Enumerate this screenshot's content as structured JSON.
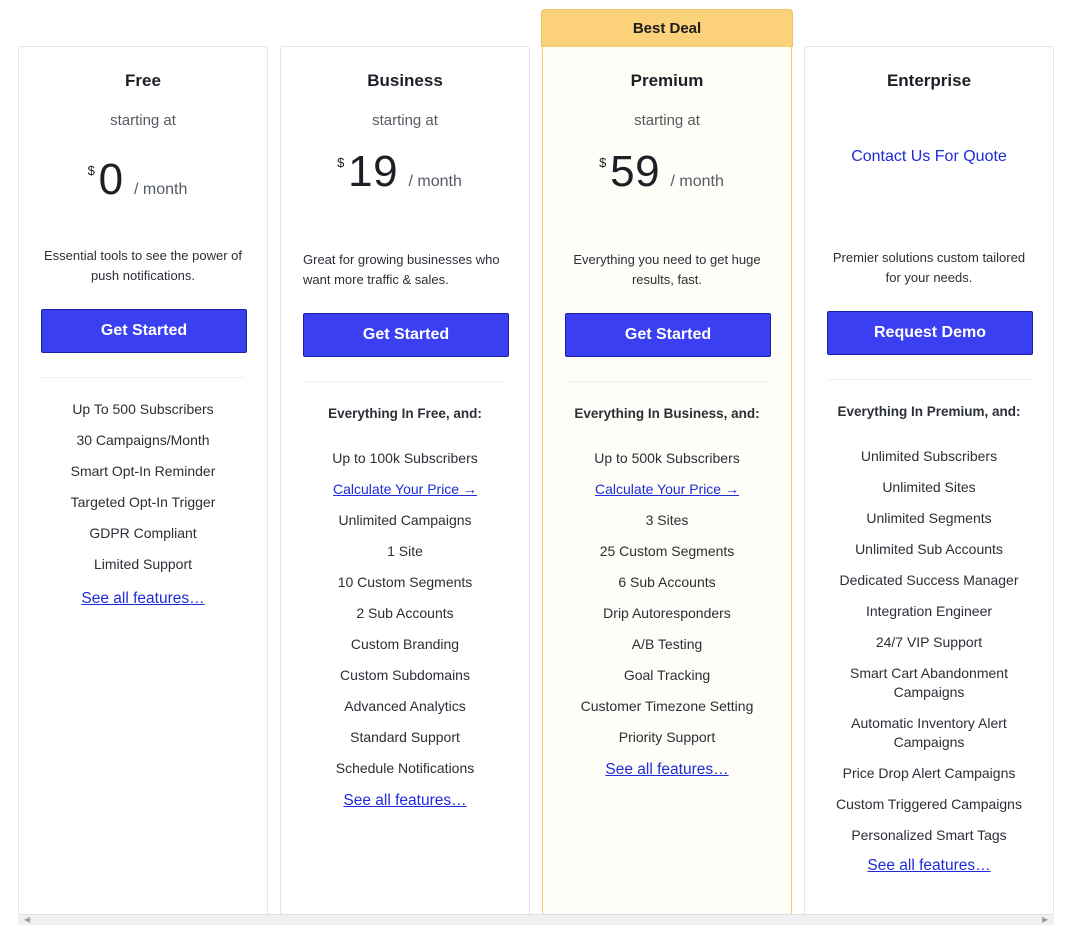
{
  "badge": "Best Deal",
  "plans": [
    {
      "name": "Free",
      "starting": "starting at",
      "currency": "$",
      "amount": "0",
      "per": "/ month",
      "description": "Essential tools to see the power of push notifications.",
      "button": "Get Started",
      "features": [
        "Up To 500 Subscribers",
        "30 Campaigns/Month",
        "Smart Opt-In Reminder",
        "Targeted Opt-In Trigger",
        "GDPR Compliant",
        "Limited Support"
      ],
      "see_all": "See all features…"
    },
    {
      "name": "Business",
      "starting": "starting at",
      "currency": "$",
      "amount": "19",
      "per": "/ month",
      "description": "Great for growing businesses who want more traffic & sales.",
      "button": "Get Started",
      "feature_head": "Everything In Free, and:",
      "features": [
        "Up to 100k Subscribers",
        "Calculate Your Price →",
        "Unlimited Campaigns",
        "1 Site",
        "10 Custom Segments",
        "2 Sub Accounts",
        "Custom Branding",
        "Custom Subdomains",
        "Advanced Analytics",
        "Standard Support",
        "Schedule Notifications"
      ],
      "see_all": "See all features…"
    },
    {
      "name": "Premium",
      "starting": "starting at",
      "currency": "$",
      "amount": "59",
      "per": "/ month",
      "description": "Everything you need to get huge results, fast.",
      "button": "Get Started",
      "feature_head": "Everything In Business, and:",
      "features": [
        "Up to 500k Subscribers",
        "Calculate Your Price →",
        "3 Sites",
        "25 Custom Segments",
        "6 Sub Accounts",
        "Drip Autoresponders",
        "A/B Testing",
        "Goal Tracking",
        "Customer Timezone Setting",
        "Priority Support"
      ],
      "see_all": "See all features…"
    },
    {
      "name": "Enterprise",
      "quote": "Contact Us For Quote",
      "description": "Premier solutions custom tailored for your needs.",
      "button": "Request Demo",
      "feature_head": "Everything In Premium, and:",
      "features": [
        "Unlimited Subscribers",
        "Unlimited Sites",
        "Unlimited Segments",
        "Unlimited Sub Accounts",
        "Dedicated Success Manager",
        "Integration Engineer",
        "24/7 VIP Support",
        "Smart Cart Abandonment Campaigns",
        "Automatic Inventory Alert Campaigns",
        "Price Drop Alert Campaigns",
        "Custom Triggered Campaigns",
        "Personalized Smart Tags"
      ],
      "see_all": "See all features…"
    }
  ],
  "colors": {
    "button": "#3a3ff2",
    "link": "#1f2bd8",
    "badge": "#fbd27a",
    "premium_bg": "#fffdf7"
  }
}
